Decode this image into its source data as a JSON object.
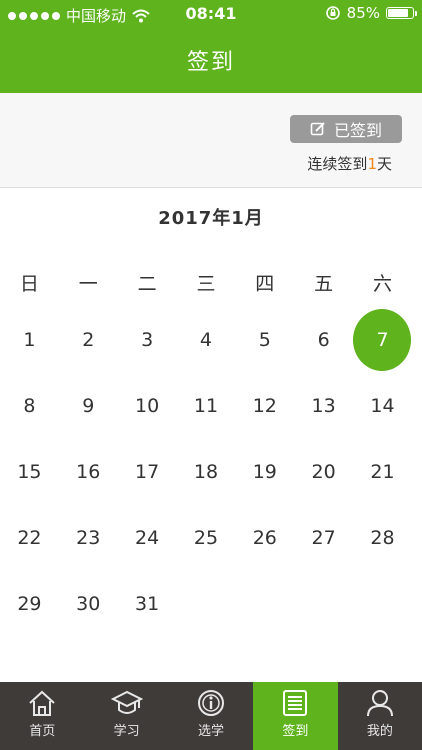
{
  "status_bar": {
    "carrier": "中国移动",
    "time": "08:41",
    "battery": "85%",
    "battery_level": 0.85
  },
  "header": {
    "title": "签到"
  },
  "sign_info": {
    "button_label": "已签到",
    "streak_prefix": "连续签到",
    "streak_days": "1",
    "streak_suffix": "天"
  },
  "calendar": {
    "month_label": "2017年1月",
    "weekdays": [
      "日",
      "一",
      "二",
      "三",
      "四",
      "五",
      "六"
    ],
    "weeks": [
      [
        "1",
        "2",
        "3",
        "4",
        "5",
        "6",
        "7"
      ],
      [
        "8",
        "9",
        "10",
        "11",
        "12",
        "13",
        "14"
      ],
      [
        "15",
        "16",
        "17",
        "18",
        "19",
        "20",
        "21"
      ],
      [
        "22",
        "23",
        "24",
        "25",
        "26",
        "27",
        "28"
      ],
      [
        "29",
        "30",
        "31",
        "",
        "",
        "",
        ""
      ]
    ],
    "today": "7",
    "accent_color": "#5fb31d"
  },
  "tabs": [
    {
      "label": "首页",
      "icon": "home-icon",
      "active": false
    },
    {
      "label": "学习",
      "icon": "graduation-cap-icon",
      "active": false
    },
    {
      "label": "选学",
      "icon": "info-circle-icon",
      "active": false
    },
    {
      "label": "签到",
      "icon": "list-icon",
      "active": true
    },
    {
      "label": "我的",
      "icon": "user-icon",
      "active": false
    }
  ]
}
